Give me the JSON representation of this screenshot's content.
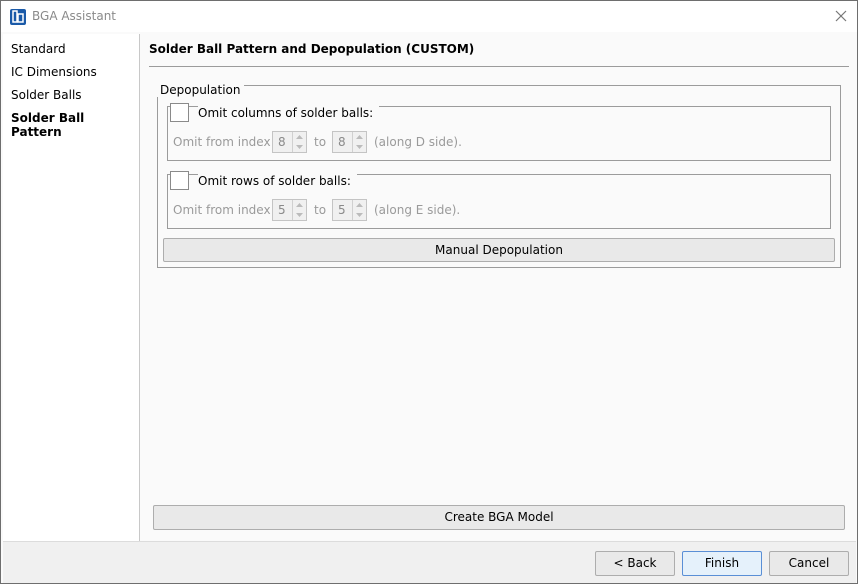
{
  "window": {
    "title": "BGA Assistant",
    "app_icon": "bga-app-icon",
    "close_icon": "close-icon"
  },
  "sidebar": {
    "items": [
      {
        "label": "Standard",
        "active": false
      },
      {
        "label": "IC Dimensions",
        "active": false
      },
      {
        "label": "Solder Balls",
        "active": false
      },
      {
        "label": "Solder Ball Pattern",
        "active": true
      }
    ]
  },
  "main": {
    "title": "Solder Ball Pattern and Depopulation (CUSTOM)",
    "depopulation": {
      "legend": "Depopulation",
      "columns": {
        "checkbox_label": "Omit columns of solder balls:",
        "checked": false,
        "from_label": "Omit from index",
        "from_value": "8",
        "to_label": "to",
        "to_value": "8",
        "suffix": "(along D side)."
      },
      "rows": {
        "checkbox_label": "Omit rows of solder balls:",
        "checked": false,
        "from_label": "Omit from index",
        "from_value": "5",
        "to_label": "to",
        "to_value": "5",
        "suffix": "(along E side)."
      },
      "manual_button": "Manual Depopulation"
    },
    "create_button": "Create BGA Model"
  },
  "footer": {
    "back": "< Back",
    "finish": "Finish",
    "cancel": "Cancel"
  },
  "colors": {
    "accent": "#1a5aa8",
    "focus_border": "#5a8fd6"
  }
}
